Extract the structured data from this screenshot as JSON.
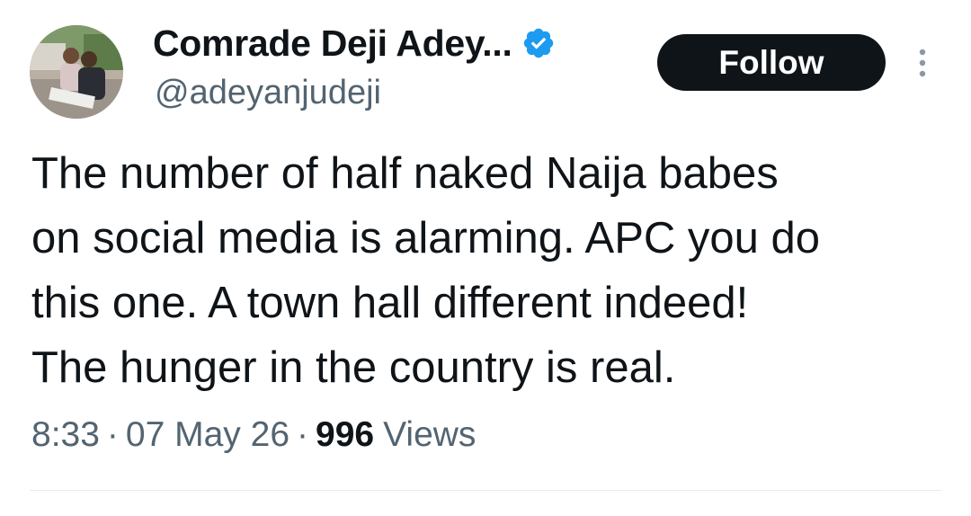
{
  "tweet": {
    "author": {
      "display_name": "Comrade Deji Adey...",
      "handle": "@adeyanjudeji",
      "verified": true,
      "avatar_icon": "profile-photo"
    },
    "follow_label": "Follow",
    "more_icon": "more-vertical-icon",
    "text_lines": [
      "The number of half naked Naija babes",
      "on social media is alarming. APC you do",
      "this one. A town hall different indeed!",
      "The hunger in the country is real."
    ],
    "time": "8:33",
    "separator": "·",
    "date": "07 May 26",
    "views_count": "996",
    "views_label": "Views"
  },
  "colors": {
    "text_primary": "#0f1419",
    "text_secondary": "#536471",
    "verified_blue": "#1d9bf0",
    "button_bg": "#0f1419",
    "divider": "#e6ecf0"
  }
}
